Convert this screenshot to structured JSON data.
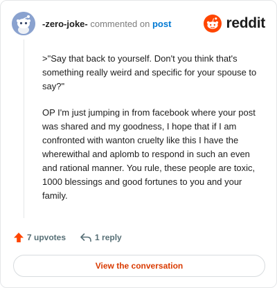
{
  "comment": {
    "author": "-zero-joke-",
    "action_text": "commented on",
    "post_link": "post",
    "body": [
      ">\"Say that back to yourself. Don't you think that's something really weird and specific for your spouse to say?\"",
      "OP I'm just jumping in from facebook where your post was shared and my goodness, I hope that if I am confronted with wanton cruelty like this I have the wherewithal and aplomb to respond in such an even and rational manner. You rule, these people are toxic, 1000 blessings and good fortunes to you and your family."
    ]
  },
  "brand": {
    "name": "reddit",
    "icon": "reddit-logo-icon",
    "color": "#ff4500"
  },
  "actions": {
    "upvotes_label": "7 upvotes",
    "upvote_icon": "upvote-arrow-icon",
    "replies_label": "1 reply",
    "reply_icon": "reply-arrow-icon"
  },
  "cta": {
    "label": "View the conversation"
  },
  "colors": {
    "accent": "#d93a00",
    "link": "#0079d3",
    "upvote": "#ff4500",
    "avatar_bg": "#8aa2cf"
  }
}
